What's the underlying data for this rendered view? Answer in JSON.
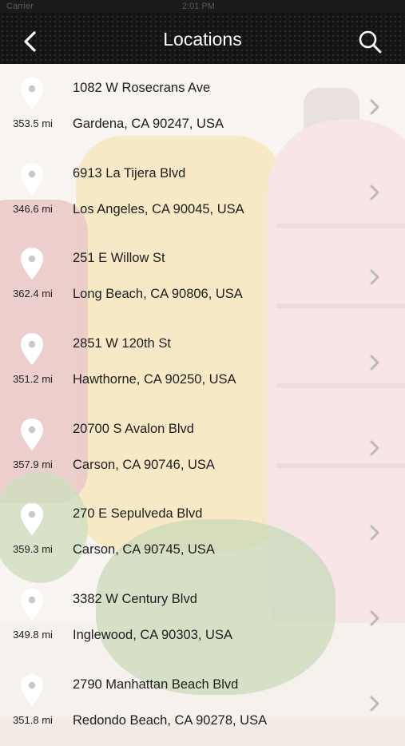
{
  "status_bar": {
    "carrier": "Carrier",
    "time": "2:01 PM"
  },
  "header": {
    "title": "Locations",
    "back_icon": "chevron-left-icon",
    "search_icon": "search-icon"
  },
  "locations": [
    {
      "distance": "353.5 mi",
      "street": "1082 W Rosecrans Ave",
      "city": "Gardena, CA 90247, USA"
    },
    {
      "distance": "346.6 mi",
      "street": "6913 La Tijera Blvd",
      "city": "Los Angeles, CA 90045, USA"
    },
    {
      "distance": "362.4 mi",
      "street": "251 E Willow St",
      "city": "Long Beach, CA 90806, USA"
    },
    {
      "distance": "351.2 mi",
      "street": "2851 W 120th St",
      "city": "Hawthorne, CA 90250, USA"
    },
    {
      "distance": "357.9 mi",
      "street": "20700 S Avalon Blvd",
      "city": "Carson, CA 90746, USA"
    },
    {
      "distance": "359.3 mi",
      "street": "270 E Sepulveda Blvd",
      "city": "Carson, CA 90745, USA"
    },
    {
      "distance": "349.8 mi",
      "street": "3382 W Century Blvd",
      "city": "Inglewood, CA 90303, USA"
    },
    {
      "distance": "351.8 mi",
      "street": "2790 Manhattan Beach Blvd",
      "city": "Redondo Beach, CA 90278, USA"
    }
  ],
  "colors": {
    "nav_background": "#141414",
    "title_text": "#ffffff",
    "pin": "#ffffff",
    "chevron": "#b9b9b9"
  }
}
